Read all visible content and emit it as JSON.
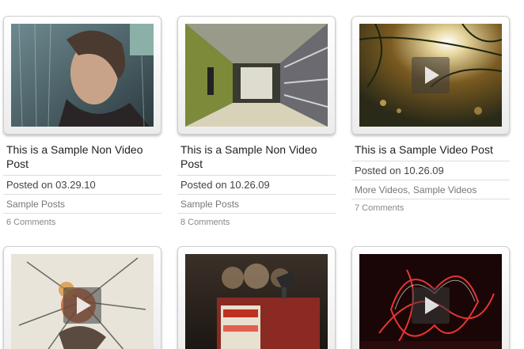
{
  "posts": [
    {
      "title": "This is a Sample Non Video Post",
      "posted": "Posted on 03.29.10",
      "categories": [
        "Sample Posts"
      ],
      "comments": "6 Comments",
      "video": false
    },
    {
      "title": "This is a Sample Non Video Post",
      "posted": "Posted on 10.26.09",
      "categories": [
        "Sample Posts"
      ],
      "comments": "8 Comments",
      "video": false
    },
    {
      "title": "This is a Sample Video Post",
      "posted": "Posted on 10.26.09",
      "categories": [
        "More Videos",
        "Sample Videos"
      ],
      "category_separator": ", ",
      "comments": "7 Comments",
      "video": true
    },
    {
      "video": true
    },
    {
      "video": false
    },
    {
      "video": true
    }
  ]
}
